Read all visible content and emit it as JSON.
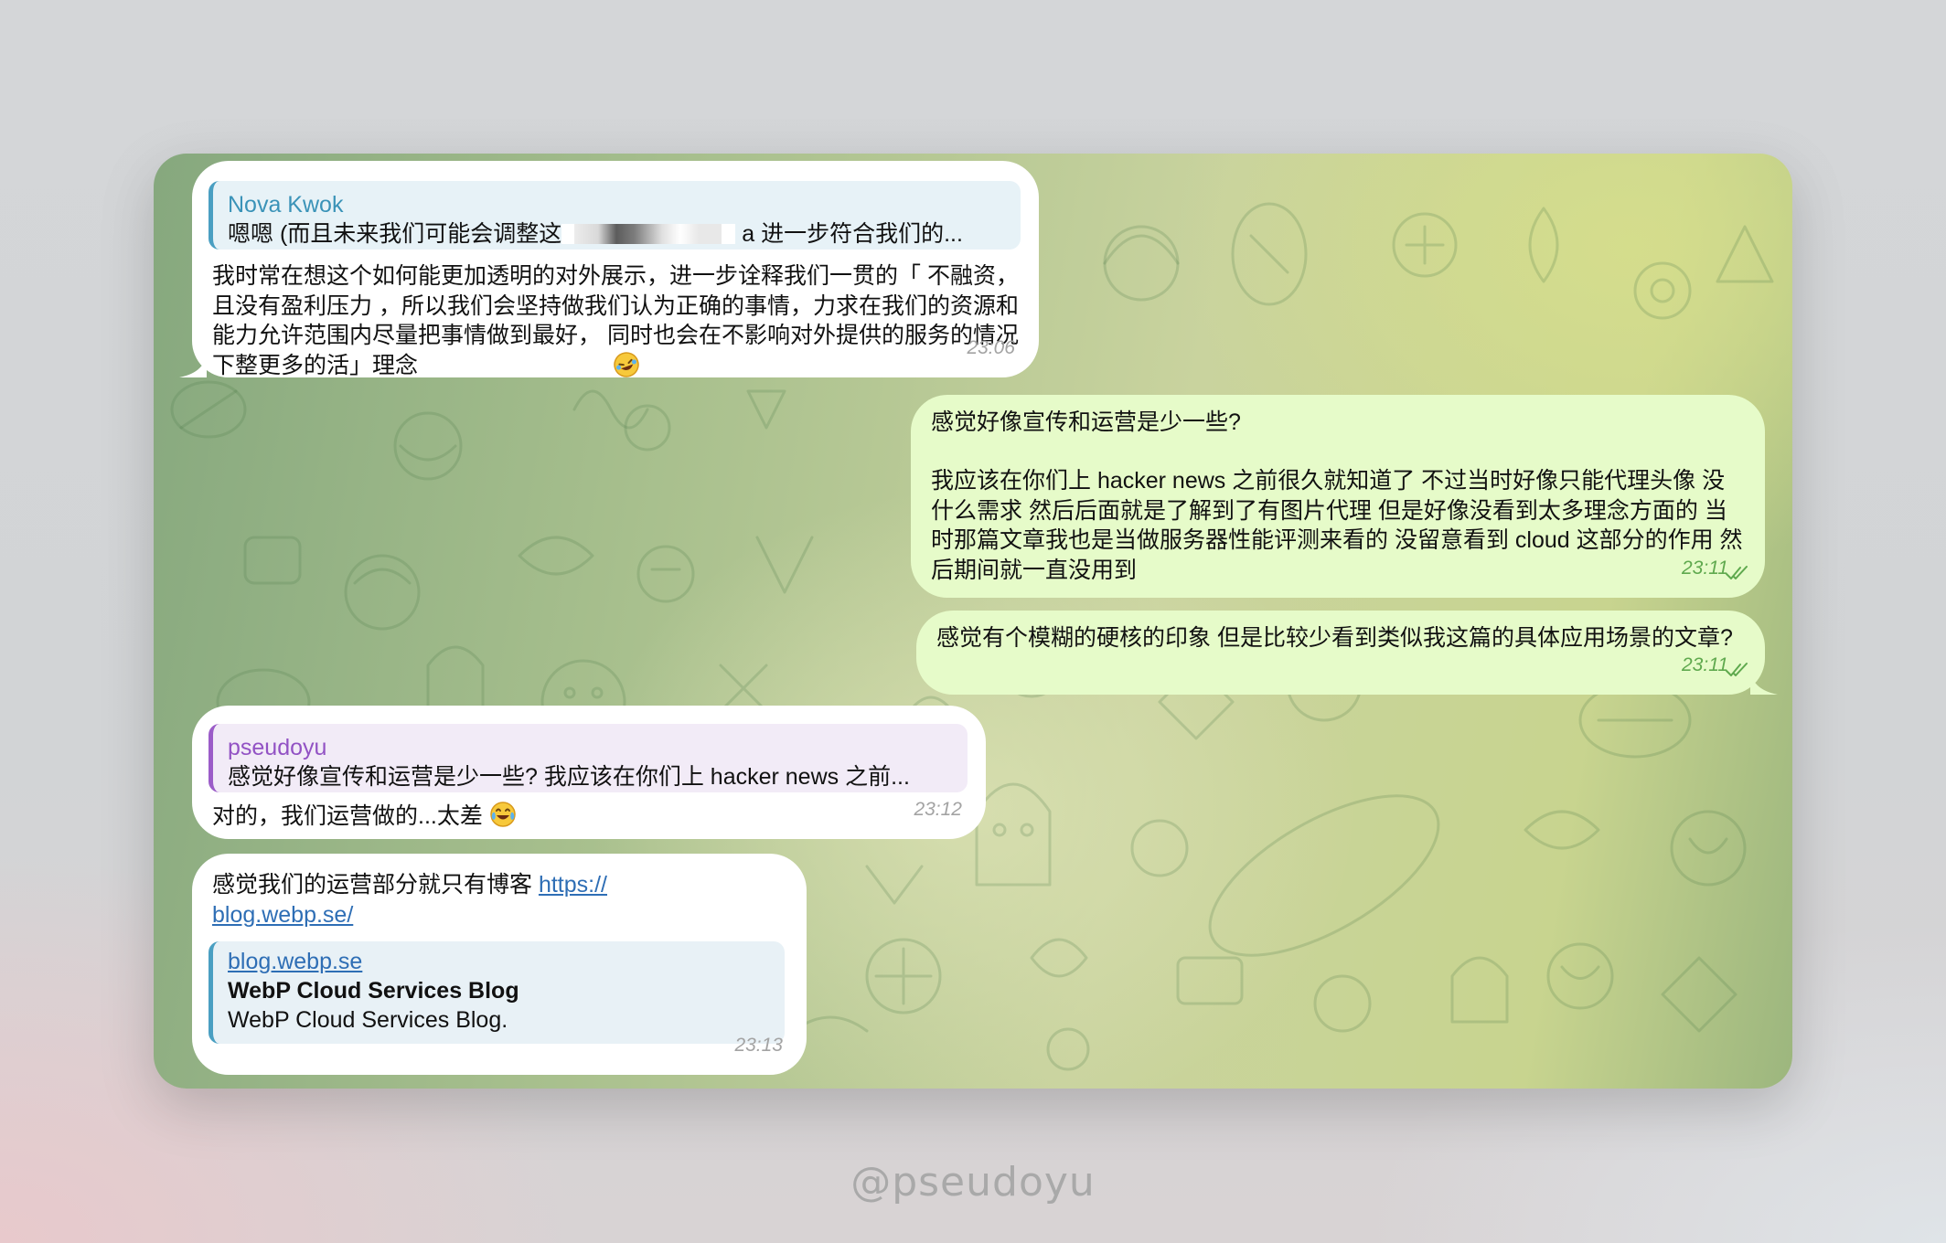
{
  "messages": [
    {
      "reply": {
        "name": "Nova Kwok",
        "text": "嗯嗯 (而且未来我们可能会调整这",
        "text_tail": "a 进一步符合我们的..."
      },
      "text": "我时常在想这个如何能更加透明的对外展示，进一步诠释我们一贯的「 不融资，且没有盈利压力 ，所以我们会坚持做我们认为正确的事情，力求在我们的资源和能力允许范围内尽量把事情做到最好， 同时也会在不影响对外提供的服务的情况下整更多的活」理念",
      "time": "23:06"
    },
    {
      "text_line1": "感觉好像宣传和运营是少一些?",
      "text_para2": "我应该在你们上 hacker news 之前很久就知道了 不过当时好像只能代理头像 没什么需求 然后后面就是了解到了有图片代理 但是好像没看到太多理念方面的 当时那篇文章我也是当做服务器性能评测来看的 没留意看到 cloud 这部分的作用 然后期间就一直没用到",
      "time": "23:11"
    },
    {
      "text": "感觉有个模糊的硬核的印象 但是比较少看到类似我这篇的具体应用场景的文章?",
      "time": "23:11"
    },
    {
      "reply": {
        "name": "pseudoyu",
        "text": "感觉好像宣传和运营是少一些? 我应该在你们上 hacker news 之前..."
      },
      "text": "对的，我们运营做的...太差",
      "time": "23:12"
    },
    {
      "text_prefix": "感觉我们的运营部分就只有博客 ",
      "link_part1": "https://",
      "link_part2": "blog.webp.se/",
      "preview": {
        "site": "blog.webp.se",
        "title": "WebP Cloud Services Blog",
        "description": "WebP Cloud Services Blog."
      },
      "time": "23:13"
    }
  ],
  "watermark": "@pseudoyu",
  "colors": {
    "incoming_bubble": "#ffffff",
    "outgoing_bubble": "#e6fbc9",
    "reply_accent_nova": "#4a9fc2",
    "reply_accent_pseudoyu": "#9b5cc8",
    "link": "#2e6eb5",
    "outgoing_time": "#5fa94e"
  },
  "icons": [
    "double-check-icon",
    "rofl-emoji-icon",
    "tears-of-joy-emoji-icon"
  ]
}
